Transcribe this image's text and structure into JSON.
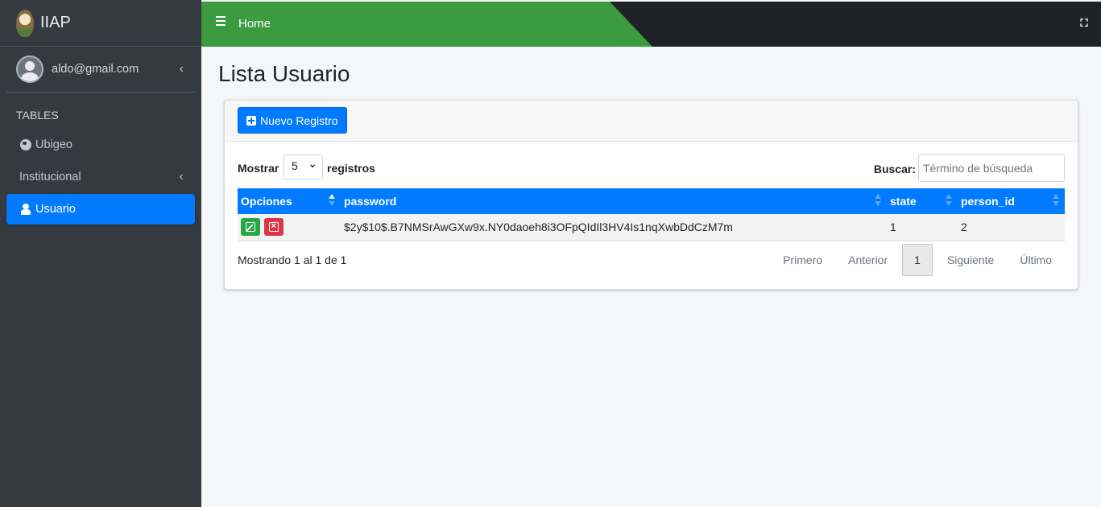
{
  "brand": {
    "name": "IIAP"
  },
  "user": {
    "email": "aldo@gmail.com"
  },
  "sidebar": {
    "header": "TABLES",
    "items": [
      {
        "label": "Ubigeo",
        "icon": "globe-icon"
      },
      {
        "label": "Institucional",
        "icon": "chevron-left-icon"
      },
      {
        "label": "Usuario",
        "icon": "user-icon",
        "active": true
      }
    ]
  },
  "topbar": {
    "home_label": "Home"
  },
  "page": {
    "title": "Lista Usuario"
  },
  "card": {
    "new_button": "Nuevo Registro",
    "show_label": "Mostrar",
    "page_size": "5",
    "records_label": "registros",
    "search_label": "Buscar:",
    "search_placeholder": "Término de búsqueda"
  },
  "table": {
    "columns": [
      "Opciones",
      "password",
      "state",
      "person_id"
    ],
    "rows": [
      {
        "password": "$2y$10$.B7NMSrAwGXw9x.NY0daoeh8i3OFpQIdIl3HV4Is1nqXwbDdCzM7m",
        "state": "1",
        "person_id": "2"
      }
    ]
  },
  "footer": {
    "info": "Mostrando 1 al 1 de 1",
    "pager": [
      "Primero",
      "Anterior",
      "1",
      "Siguiente",
      "Último"
    ]
  },
  "colors": {
    "primary": "#007bff",
    "sidebar": "#343a40",
    "topbar_green": "#3c9a3f",
    "success": "#28a745",
    "danger": "#dc3545"
  }
}
